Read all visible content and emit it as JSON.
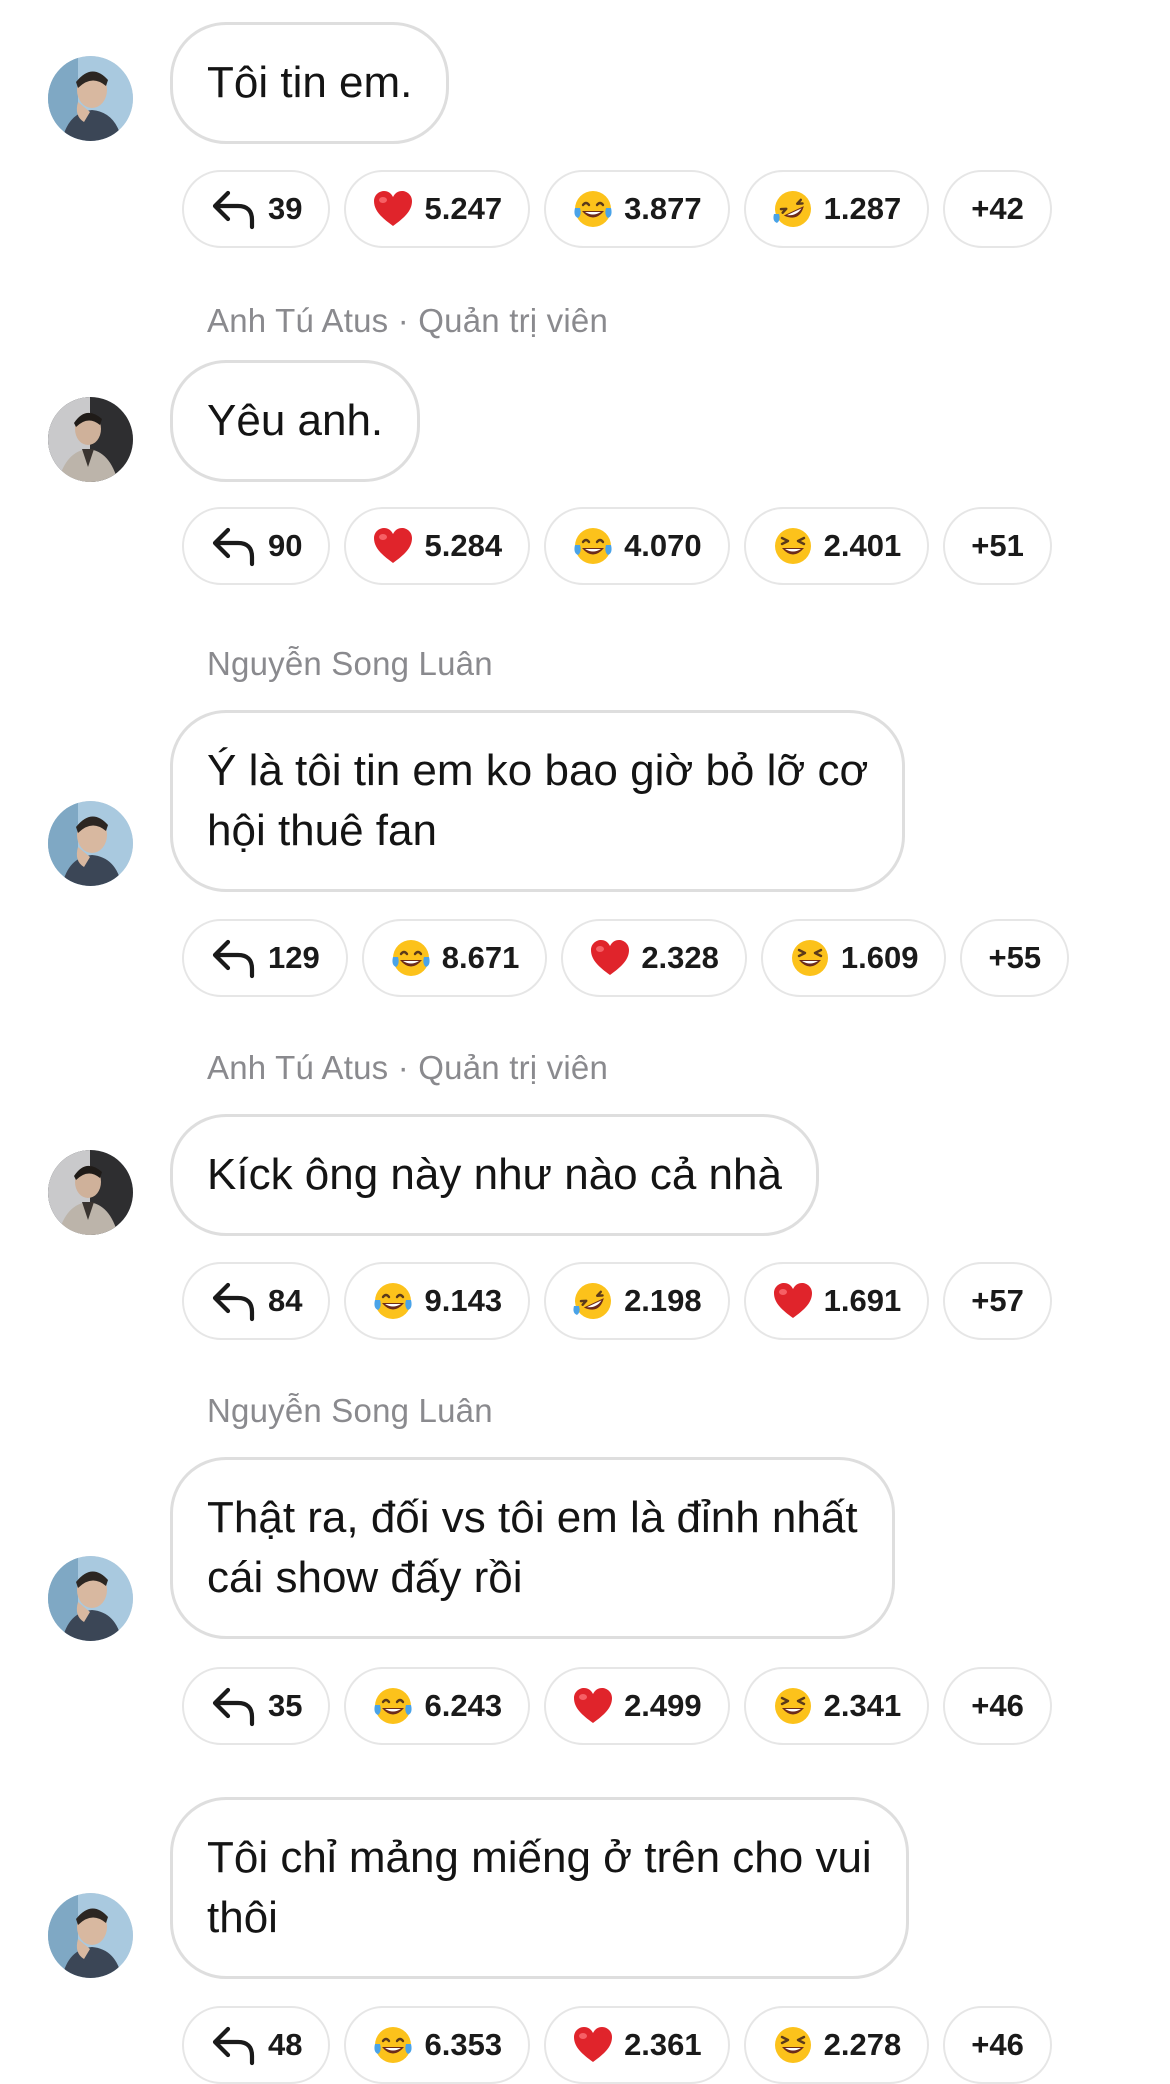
{
  "messages": [
    {
      "sender": "",
      "avatar": "avatar-blue-photo",
      "text": "Tôi tin em.",
      "replies": "39",
      "reactions": [
        {
          "icon": "red-heart-icon",
          "count": "5.247"
        },
        {
          "icon": "face-with-tears-of-joy-icon",
          "count": "3.877"
        },
        {
          "icon": "rolling-on-floor-laughing-icon",
          "count": "1.287"
        }
      ],
      "more": "+42"
    },
    {
      "sender": "Anh Tú Atus · Quản trị viên",
      "avatar": "avatar-dark-photo",
      "text": "Yêu anh.",
      "replies": "90",
      "reactions": [
        {
          "icon": "red-heart-icon",
          "count": "5.284"
        },
        {
          "icon": "face-with-tears-of-joy-icon",
          "count": "4.070"
        },
        {
          "icon": "grinning-squinting-face-icon",
          "count": "2.401"
        }
      ],
      "more": "+51"
    },
    {
      "sender": "Nguyễn Song Luân",
      "avatar": "avatar-blue-photo",
      "text_lines": [
        "Ý là tôi tin em ko bao giờ bỏ lỡ cơ",
        "hội thuê fan"
      ],
      "replies": "129",
      "reactions": [
        {
          "icon": "face-with-tears-of-joy-icon",
          "count": "8.671"
        },
        {
          "icon": "red-heart-icon",
          "count": "2.328"
        },
        {
          "icon": "grinning-squinting-face-icon",
          "count": "1.609"
        }
      ],
      "more": "+55"
    },
    {
      "sender": "Anh Tú Atus · Quản trị viên",
      "avatar": "avatar-dark-photo",
      "text": "Kíck ông này như nào cả nhà",
      "replies": "84",
      "reactions": [
        {
          "icon": "face-with-tears-of-joy-icon",
          "count": "9.143"
        },
        {
          "icon": "rolling-on-floor-laughing-icon",
          "count": "2.198"
        },
        {
          "icon": "red-heart-icon",
          "count": "1.691"
        }
      ],
      "more": "+57"
    },
    {
      "sender": "Nguyễn Song Luân",
      "avatar": "avatar-blue-photo",
      "text_lines": [
        "Thật ra, đối vs tôi em là đỉnh nhất",
        "cái show đấy rồi"
      ],
      "replies": "35",
      "reactions": [
        {
          "icon": "face-with-tears-of-joy-icon",
          "count": "6.243"
        },
        {
          "icon": "red-heart-icon",
          "count": "2.499"
        },
        {
          "icon": "grinning-squinting-face-icon",
          "count": "2.341"
        }
      ],
      "more": "+46"
    },
    {
      "sender": "",
      "avatar": "avatar-blue-photo",
      "text_lines": [
        "Tôi chỉ mảng miếng ở trên cho vui",
        "thôi"
      ],
      "replies": "48",
      "reactions": [
        {
          "icon": "face-with-tears-of-joy-icon",
          "count": "6.353"
        },
        {
          "icon": "red-heart-icon",
          "count": "2.361"
        },
        {
          "icon": "grinning-squinting-face-icon",
          "count": "2.278"
        }
      ],
      "more": "+46"
    }
  ]
}
